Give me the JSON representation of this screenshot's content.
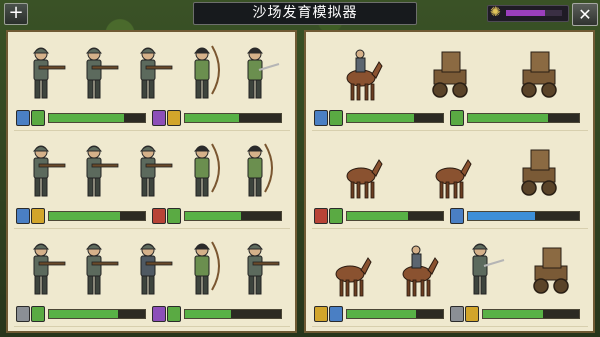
{
  "title": "沙场发育模拟器",
  "top": {
    "plus": "+",
    "close": "✕",
    "resource_fill": 0.7,
    "resource_color": "#9b3fbd"
  },
  "left_cards": [
    {
      "units": [
        "rifleman",
        "rifleman",
        "rifleman",
        "archer",
        "swordsman"
      ],
      "stats": [
        {
          "badges": [
            "blue",
            "green"
          ],
          "fill": 0.78,
          "color": "#58b146"
        },
        {
          "badges": [
            "purple",
            "yellow"
          ],
          "fill": 0.56,
          "color": "#58b146"
        }
      ]
    },
    {
      "units": [
        "rifleman",
        "rifleman",
        "rifleman",
        "archer",
        "archer"
      ],
      "stats": [
        {
          "badges": [
            "blue",
            "yellow"
          ],
          "fill": 0.74,
          "color": "#58b146"
        },
        {
          "badges": [
            "red",
            "green"
          ],
          "fill": 0.58,
          "color": "#58b146"
        }
      ]
    },
    {
      "units": [
        "rifleman",
        "rifleman",
        "knight",
        "archer",
        "rifleman"
      ],
      "stats": [
        {
          "badges": [
            "gray",
            "green"
          ],
          "fill": 0.72,
          "color": "#58b146"
        },
        {
          "badges": [
            "purple",
            "green"
          ],
          "fill": 0.48,
          "color": "#58b146"
        }
      ]
    }
  ],
  "right_cards": [
    {
      "units": [
        "cavalry",
        "catapult",
        "catapult"
      ],
      "stats": [
        {
          "badges": [
            "blue",
            "green"
          ],
          "fill": 0.7,
          "color": "#58b146"
        },
        {
          "badges": [
            "green"
          ],
          "fill": 0.72,
          "color": "#58b146"
        }
      ]
    },
    {
      "units": [
        "horse",
        "horse",
        "catapult"
      ],
      "stats": [
        {
          "badges": [
            "red",
            "green"
          ],
          "fill": 0.64,
          "color": "#58b146"
        },
        {
          "badges": [
            "blue"
          ],
          "fill": 0.6,
          "color": "#3d8fd8"
        }
      ]
    },
    {
      "units": [
        "horse",
        "cavalry",
        "spearman",
        "catapult"
      ],
      "stats": [
        {
          "badges": [
            "yellow",
            "blue"
          ],
          "fill": 0.72,
          "color": "#58b146"
        },
        {
          "badges": [
            "gray",
            "yellow"
          ],
          "fill": 0.62,
          "color": "#58b146"
        }
      ]
    }
  ]
}
